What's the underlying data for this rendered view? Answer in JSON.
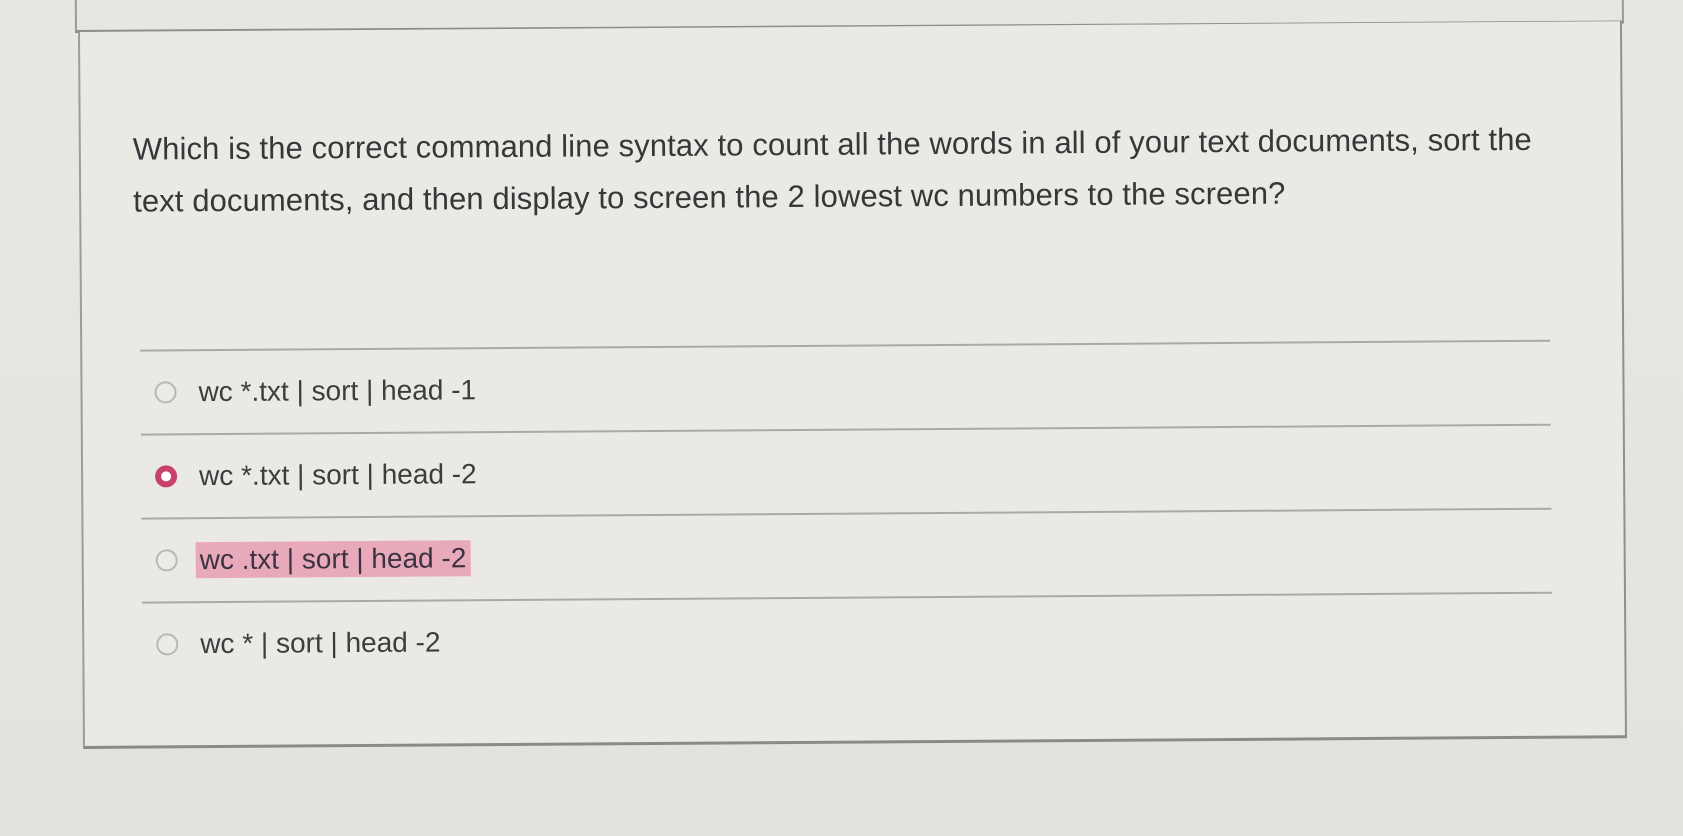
{
  "question": {
    "text": "Which is the correct command line syntax to count all the words in all of your text documents, sort the text documents, and then display to screen the 2 lowest wc numbers to the screen?"
  },
  "answers": [
    {
      "label": "wc *.txt | sort | head -1",
      "selected": false,
      "highlighted": false
    },
    {
      "label": "wc *.txt | sort | head -2",
      "selected": true,
      "highlighted": false
    },
    {
      "label": "wc .txt | sort | head -2",
      "selected": false,
      "highlighted": true
    },
    {
      "label": "wc * | sort | head -2",
      "selected": false,
      "highlighted": false
    }
  ],
  "colors": {
    "selected_radio": "#c8426e",
    "highlight": "#e8a9bb",
    "background": "#e6e4df",
    "text": "#3b3b3e"
  }
}
